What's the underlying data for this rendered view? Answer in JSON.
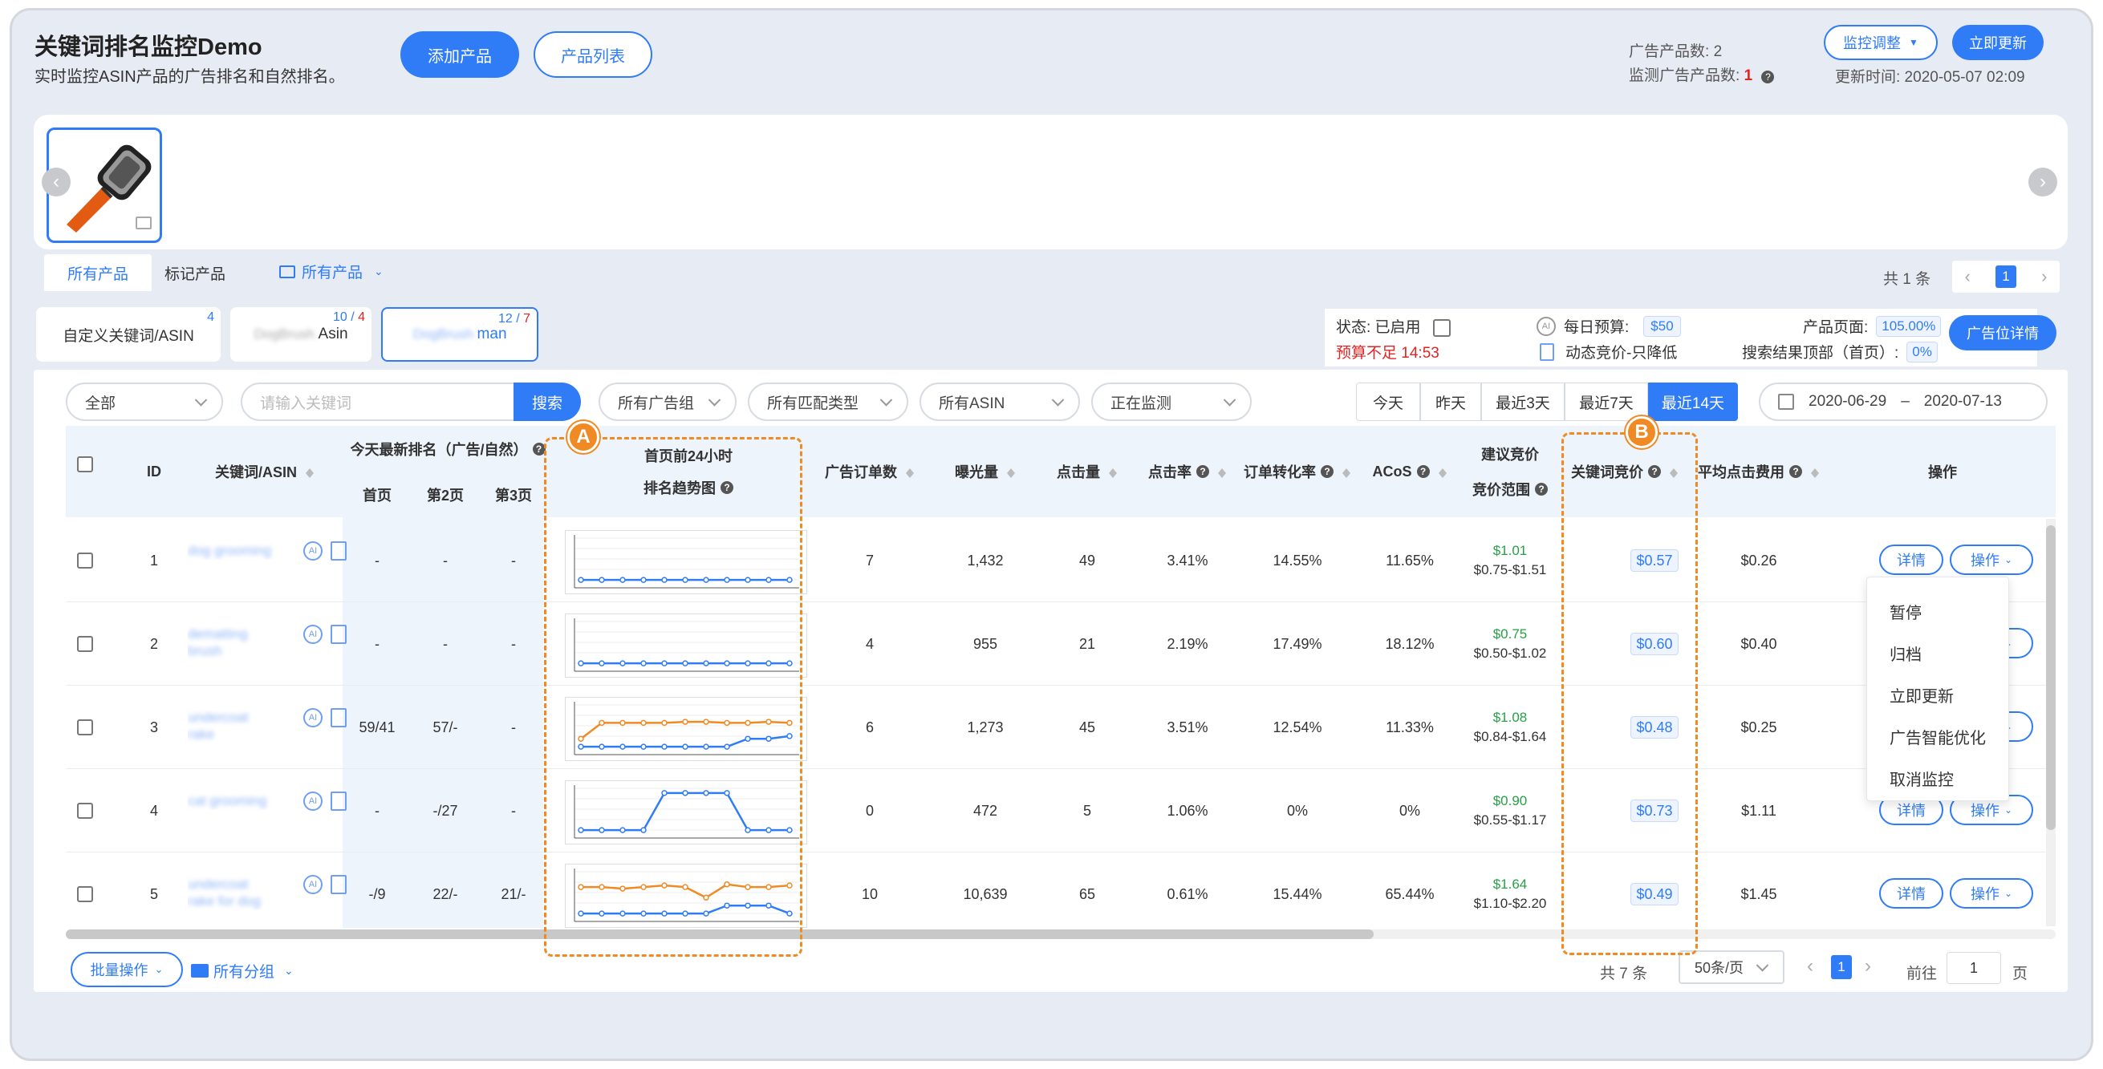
{
  "header": {
    "title": "关键词排名监控Demo",
    "subtitle": "实时监控ASIN产品的广告排名和自然排名。",
    "add_product": "添加产品",
    "product_list": "产品列表",
    "ad_products_label": "广告产品数:",
    "ad_products_value": "2",
    "monitored_label": "监测广告产品数:",
    "monitored_value": "1",
    "monitor_adjust": "监控调整",
    "update_now": "立即更新",
    "update_time": "更新时间: 2020-05-07 02:09"
  },
  "filter_tabs": {
    "all_products": "所有产品",
    "marked_products": "标记产品",
    "folder_select": "所有产品",
    "total": "共 1 条",
    "page": "1"
  },
  "asin_tabs": [
    {
      "label": "自定义关键词/ASIN",
      "count": "4",
      "count_red": ""
    },
    {
      "label": "Asin",
      "blur": "DogBrush",
      "count": "10 / ",
      "count_red": "4"
    },
    {
      "label": "man",
      "blur": "DogBrush",
      "count": "12 / ",
      "count_red": "7"
    }
  ],
  "status": {
    "status_label": "状态: 已启用",
    "budget_warn": "预算不足 14:53",
    "daily_budget_label": "每日预算:",
    "daily_budget_value": "$50",
    "dynamic_bid": "动态竞价-只降低",
    "product_page_label": "产品页面:",
    "product_page_value": "105.00%",
    "top_search_label": "搜索结果顶部（首页）:",
    "top_search_value": "0%",
    "placement_btn": "广告位详情"
  },
  "toolbar": {
    "all": "全部",
    "keyword_placeholder": "请输入关键词",
    "search": "搜索",
    "ad_group": "所有广告组",
    "match_type": "所有匹配类型",
    "asin": "所有ASIN",
    "monitoring": "正在监测",
    "ranges": [
      "今天",
      "昨天",
      "最近3天",
      "最近7天",
      "最近14天"
    ],
    "date_from": "2020-06-29",
    "date_sep": "–",
    "date_to": "2020-07-13"
  },
  "table": {
    "headers": {
      "id": "ID",
      "keyword": "关键词/ASIN",
      "today_rank": "今天最新排名（广告/自然）",
      "page1": "首页",
      "page2": "第2页",
      "page3": "第3页",
      "trend_title": "首页前24小时",
      "trend_sub": "排名趋势图",
      "orders": "广告订单数",
      "impressions": "曝光量",
      "clicks": "点击量",
      "ctr": "点击率",
      "cvr": "订单转化率",
      "acos": "ACoS",
      "suggest1": "建议竞价",
      "suggest2": "竞价范围",
      "bid": "关键词竞价",
      "cpc": "平均点击费用",
      "ops": "操作"
    },
    "rows": [
      {
        "id": "1",
        "kw": "dog grooming",
        "p1": "-",
        "p2": "-",
        "p3": "-",
        "orders": "7",
        "impr": "1,432",
        "clicks": "49",
        "ctr": "3.41%",
        "cvr": "14.55%",
        "acos": "11.65%",
        "sug": "$1.01",
        "range": "$0.75-$1.51",
        "bid": "$0.57",
        "cpc": "$0.26"
      },
      {
        "id": "2",
        "kw": "dematting brush",
        "p1": "-",
        "p2": "-",
        "p3": "-",
        "orders": "4",
        "impr": "955",
        "clicks": "21",
        "ctr": "2.19%",
        "cvr": "17.49%",
        "acos": "18.12%",
        "sug": "$0.75",
        "range": "$0.50-$1.02",
        "bid": "$0.60",
        "cpc": "$0.40"
      },
      {
        "id": "3",
        "kw": "undercoat rake",
        "p1": "59/41",
        "p2": "57/-",
        "p3": "-",
        "orders": "6",
        "impr": "1,273",
        "clicks": "45",
        "ctr": "3.51%",
        "cvr": "12.54%",
        "acos": "11.33%",
        "sug": "$1.08",
        "range": "$0.84-$1.64",
        "bid": "$0.48",
        "cpc": "$0.25"
      },
      {
        "id": "4",
        "kw": "cat grooming",
        "p1": "-",
        "p2": "-/27",
        "p3": "-",
        "orders": "0",
        "impr": "472",
        "clicks": "5",
        "ctr": "1.06%",
        "cvr": "0%",
        "acos": "0%",
        "sug": "$0.90",
        "range": "$0.55-$1.17",
        "bid": "$0.73",
        "cpc": "$1.11"
      },
      {
        "id": "5",
        "kw": "undercoat rake for dog",
        "p1": "-/9",
        "p2": "22/-",
        "p3": "21/-",
        "orders": "10",
        "impr": "10,639",
        "clicks": "65",
        "ctr": "0.61%",
        "cvr": "15.44%",
        "acos": "65.44%",
        "sug": "$1.64",
        "range": "$1.10-$2.20",
        "bid": "$0.49",
        "cpc": "$1.45"
      }
    ],
    "details": "详情",
    "operate": "操作"
  },
  "dropdown_menu": [
    "暂停",
    "归档",
    "立即更新",
    "广告智能优化",
    "取消监控"
  ],
  "markers": {
    "a": "A",
    "b": "B"
  },
  "footer": {
    "batch": "批量操作",
    "group": "所有分组",
    "total": "共 7 条",
    "page_size": "50条/页",
    "page": "1",
    "goto": "前往",
    "goto_value": "1",
    "page_unit": "页"
  },
  "colors": {
    "accent": "#2f7cf6",
    "orange": "#f08a24",
    "red": "#e02424",
    "green": "#26a045"
  }
}
